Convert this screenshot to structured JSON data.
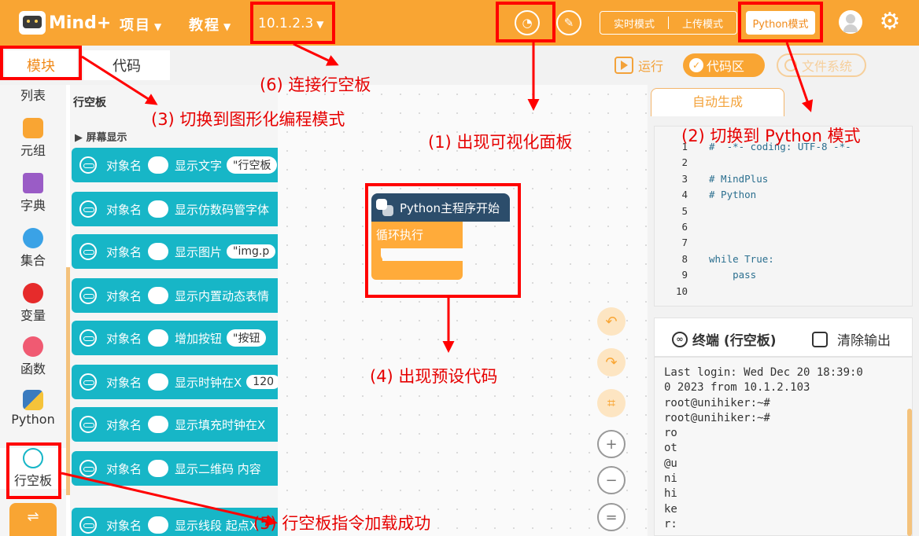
{
  "topbar": {
    "logo_text": "Mind+",
    "menu_project": "项目",
    "menu_tutorial": "教程",
    "device_ip": "10.1.2.3",
    "mode_realtime": "实时模式",
    "mode_upload": "上传模式",
    "mode_python": "Python模式"
  },
  "tabs": {
    "blocks": "模块",
    "code": "代码"
  },
  "toolbar": {
    "run": "运行",
    "code_area": "代码区",
    "file_system": "文件系统"
  },
  "categories": [
    {
      "label": "列表",
      "color": "#f08a1a"
    },
    {
      "label": "元组",
      "color": "#f9a533"
    },
    {
      "label": "字典",
      "color": "#9a5cc6"
    },
    {
      "label": "集合",
      "color": "#3aa2e6"
    },
    {
      "label": "变量",
      "color": "#e62b2b"
    },
    {
      "label": "函数",
      "color": "#f05a72"
    },
    {
      "label": "Python",
      "color": "#3a7bbf"
    },
    {
      "label": "行空板",
      "color": "#17b6c7"
    }
  ],
  "palette": {
    "title": "行空板",
    "subtitle": "屏幕显示",
    "object_label": "对象名",
    "blocks": [
      {
        "text": "显示文字",
        "arg": "\"行空板"
      },
      {
        "text": "显示仿数码管字体",
        "arg": ""
      },
      {
        "text": "显示图片",
        "arg": "\"img.p"
      },
      {
        "text": "显示内置动态表情",
        "arg": ""
      },
      {
        "text": "增加按钮",
        "arg": "\"按钮"
      },
      {
        "text": "显示时钟在X",
        "arg": "120"
      },
      {
        "text": "显示填充时钟在X",
        "arg": ""
      },
      {
        "text": "显示二维码 内容",
        "arg": ""
      },
      {
        "text": "显示线段 起点X",
        "arg": ""
      }
    ]
  },
  "workspace": {
    "main_block": "Python主程序开始",
    "loop_block": "循环执行"
  },
  "right_panel": {
    "autogen_tab": "自动生成",
    "code_lines": [
      {
        "n": "1",
        "t": "#  -*- coding: UTF-8 -*-"
      },
      {
        "n": "2",
        "t": ""
      },
      {
        "n": "3",
        "t": "# MindPlus"
      },
      {
        "n": "4",
        "t": "# Python"
      },
      {
        "n": "5",
        "t": ""
      },
      {
        "n": "6",
        "t": ""
      },
      {
        "n": "7",
        "t": ""
      },
      {
        "n": "8",
        "t": "while True:"
      },
      {
        "n": "9",
        "t": "    pass"
      },
      {
        "n": "10",
        "t": ""
      }
    ],
    "terminal_title": "终端 (行空板)",
    "clear_output": "清除输出",
    "terminal_text": "Last login: Wed Dec 20 18:39:0\n0 2023 from 10.1.2.103\nroot@unihiker:~#\nroot@unihiker:~#\nro\not\n@u\nni\nhi\nke\nr:"
  },
  "annotations": {
    "a1": "(1) 出现可视化面板",
    "a2": "(2) 切换到 Python 模式",
    "a3": "(3) 切换到图形化编程模式",
    "a4": "(4) 出现预设代码",
    "a5": "(5) 行空板指令加载成功",
    "a6": "(6) 连接行空板"
  }
}
